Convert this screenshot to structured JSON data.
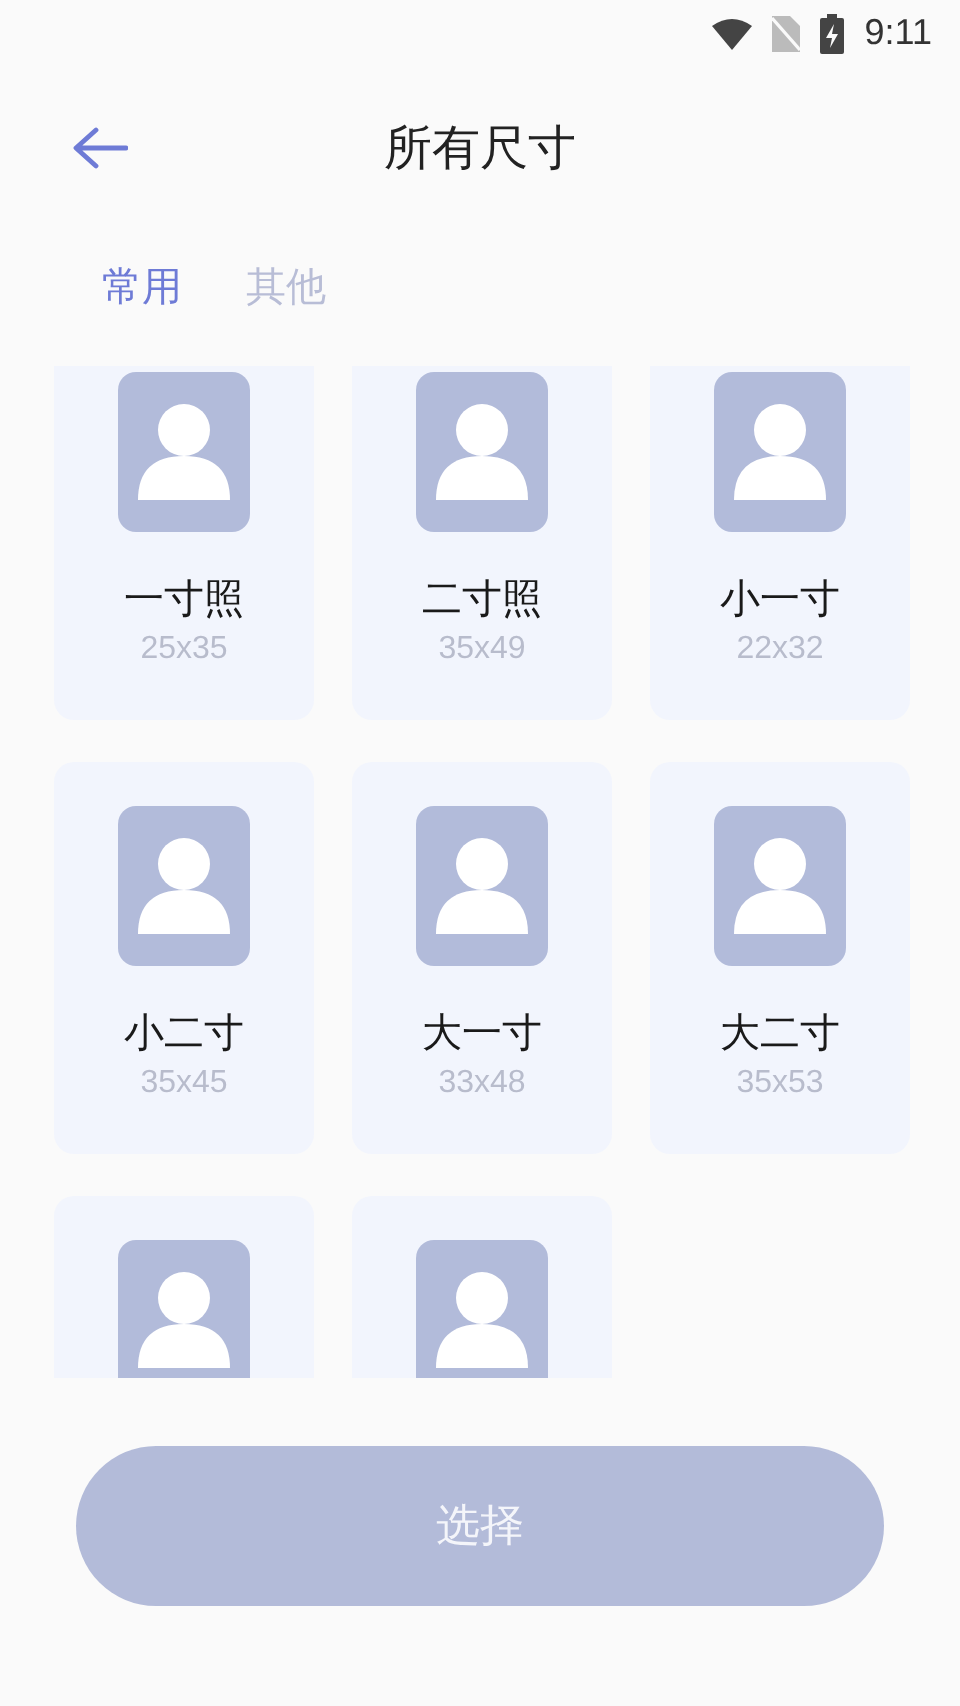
{
  "status_bar": {
    "time": "9:11"
  },
  "header": {
    "title": "所有尺寸"
  },
  "tabs": [
    {
      "label": "常用",
      "selected": true
    },
    {
      "label": "其他",
      "selected": false
    }
  ],
  "sizes": [
    {
      "kind": "full",
      "name": "一寸照",
      "size": "25x35"
    },
    {
      "kind": "full",
      "name": "二寸照",
      "size": "35x49"
    },
    {
      "kind": "full",
      "name": "小一寸",
      "size": "22x32"
    },
    {
      "kind": "full",
      "name": "小二寸",
      "size": "35x45"
    },
    {
      "kind": "full",
      "name": "大一寸",
      "size": "33x48"
    },
    {
      "kind": "full",
      "name": "大二寸",
      "size": "35x53"
    },
    {
      "kind": "cut"
    },
    {
      "kind": "cut"
    }
  ],
  "action_button": {
    "label": "选择"
  }
}
